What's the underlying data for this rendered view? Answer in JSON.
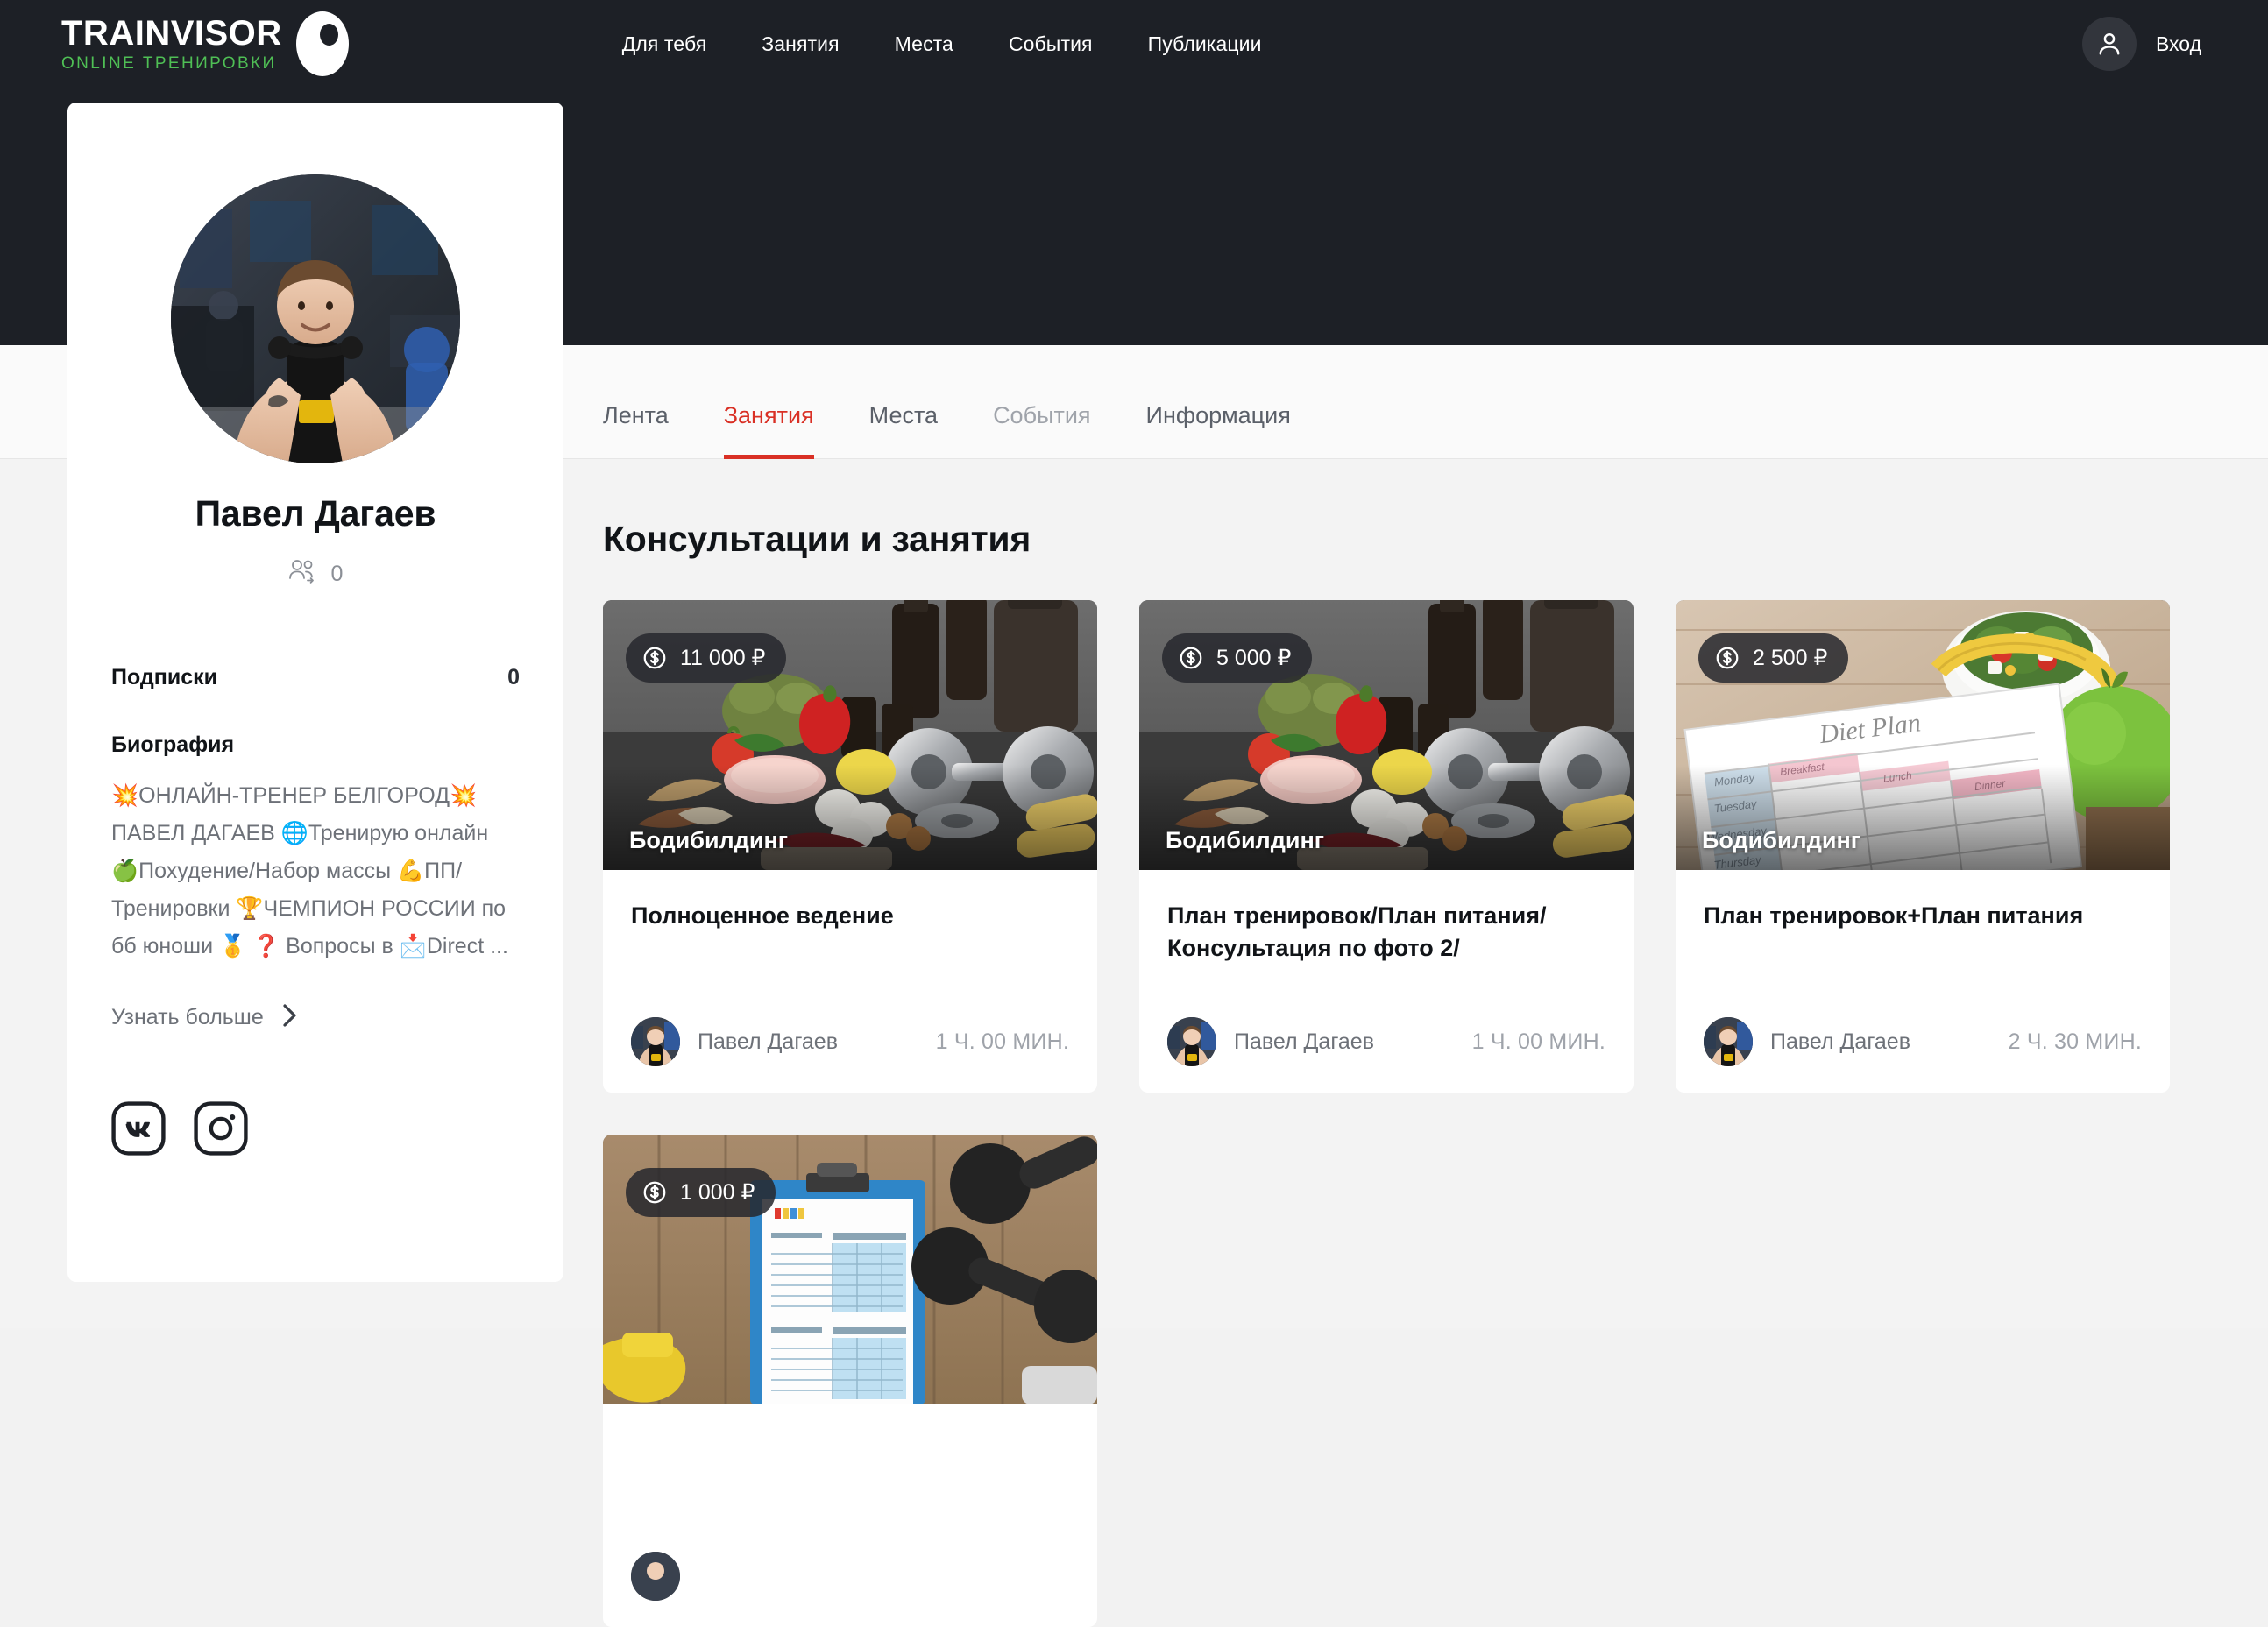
{
  "header": {
    "logo": {
      "main": "TRAINVISOR",
      "sub": "ONLINE ТРЕНИРОВКИ",
      "icon": "eye-icon"
    },
    "nav": [
      {
        "label": "Для тебя"
      },
      {
        "label": "Занятия"
      },
      {
        "label": "Места"
      },
      {
        "label": "События"
      },
      {
        "label": "Публикации"
      }
    ],
    "account": {
      "label": "Вход",
      "icon": "person-icon"
    }
  },
  "profile": {
    "name": "Павел Дагаев",
    "followers_count": "0",
    "followers_icon": "followers-icon",
    "subscriptions_label": "Подписки",
    "subscriptions_value": "0",
    "bio_label": "Биография",
    "bio_text": "💥ОНЛАЙН-ТРЕНЕР БЕЛГОРОД💥 ПАВЕЛ ДАГАЕВ 🌐Тренирую онлайн 🍏Похудение/Набор массы 💪ПП/Тренировки 🏆ЧЕМПИОН РОССИИ по бб юноши 🥇 ❓ Вопросы в 📩Direct ...",
    "more_label": "Узнать больше",
    "more_icon": "chevron-right-icon",
    "socials": [
      {
        "name": "vk-icon"
      },
      {
        "name": "instagram-icon"
      }
    ]
  },
  "tabs": [
    {
      "label": "Лента",
      "state": "normal"
    },
    {
      "label": "Занятия",
      "state": "active"
    },
    {
      "label": "Места",
      "state": "normal"
    },
    {
      "label": "События",
      "state": "dim"
    },
    {
      "label": "Информация",
      "state": "normal"
    }
  ],
  "main": {
    "section_title": "Консультации и занятия",
    "cards": [
      {
        "price": "11 000 ₽",
        "category": "Бодибилдинг",
        "title": "Полноценное ведение",
        "author": "Павел Дагаев",
        "duration": "1 Ч. 00 МИН.",
        "image": "nutrition-and-dumbbells"
      },
      {
        "price": "5 000 ₽",
        "category": "Бодибилдинг",
        "title": "План тренировок/План питания/Консультация по фото 2/",
        "author": "Павел Дагаев",
        "duration": "1 Ч. 00 МИН.",
        "image": "nutrition-and-dumbbells"
      },
      {
        "price": "2 500 ₽",
        "category": "Бодибилдинг",
        "title": "План тренировок+План питания",
        "author": "Павел Дагаев",
        "duration": "2 Ч. 30 МИН.",
        "image": "diet-plan-salad"
      },
      {
        "price": "1 000 ₽",
        "category": "",
        "title": "",
        "author": "",
        "duration": "",
        "image": "clipboard-and-dumbbells"
      }
    ]
  },
  "colors": {
    "header_bg": "#1d2026",
    "accent_green": "#4fbf55",
    "accent_red": "#d93025",
    "page_bg": "#f3f3f3"
  }
}
